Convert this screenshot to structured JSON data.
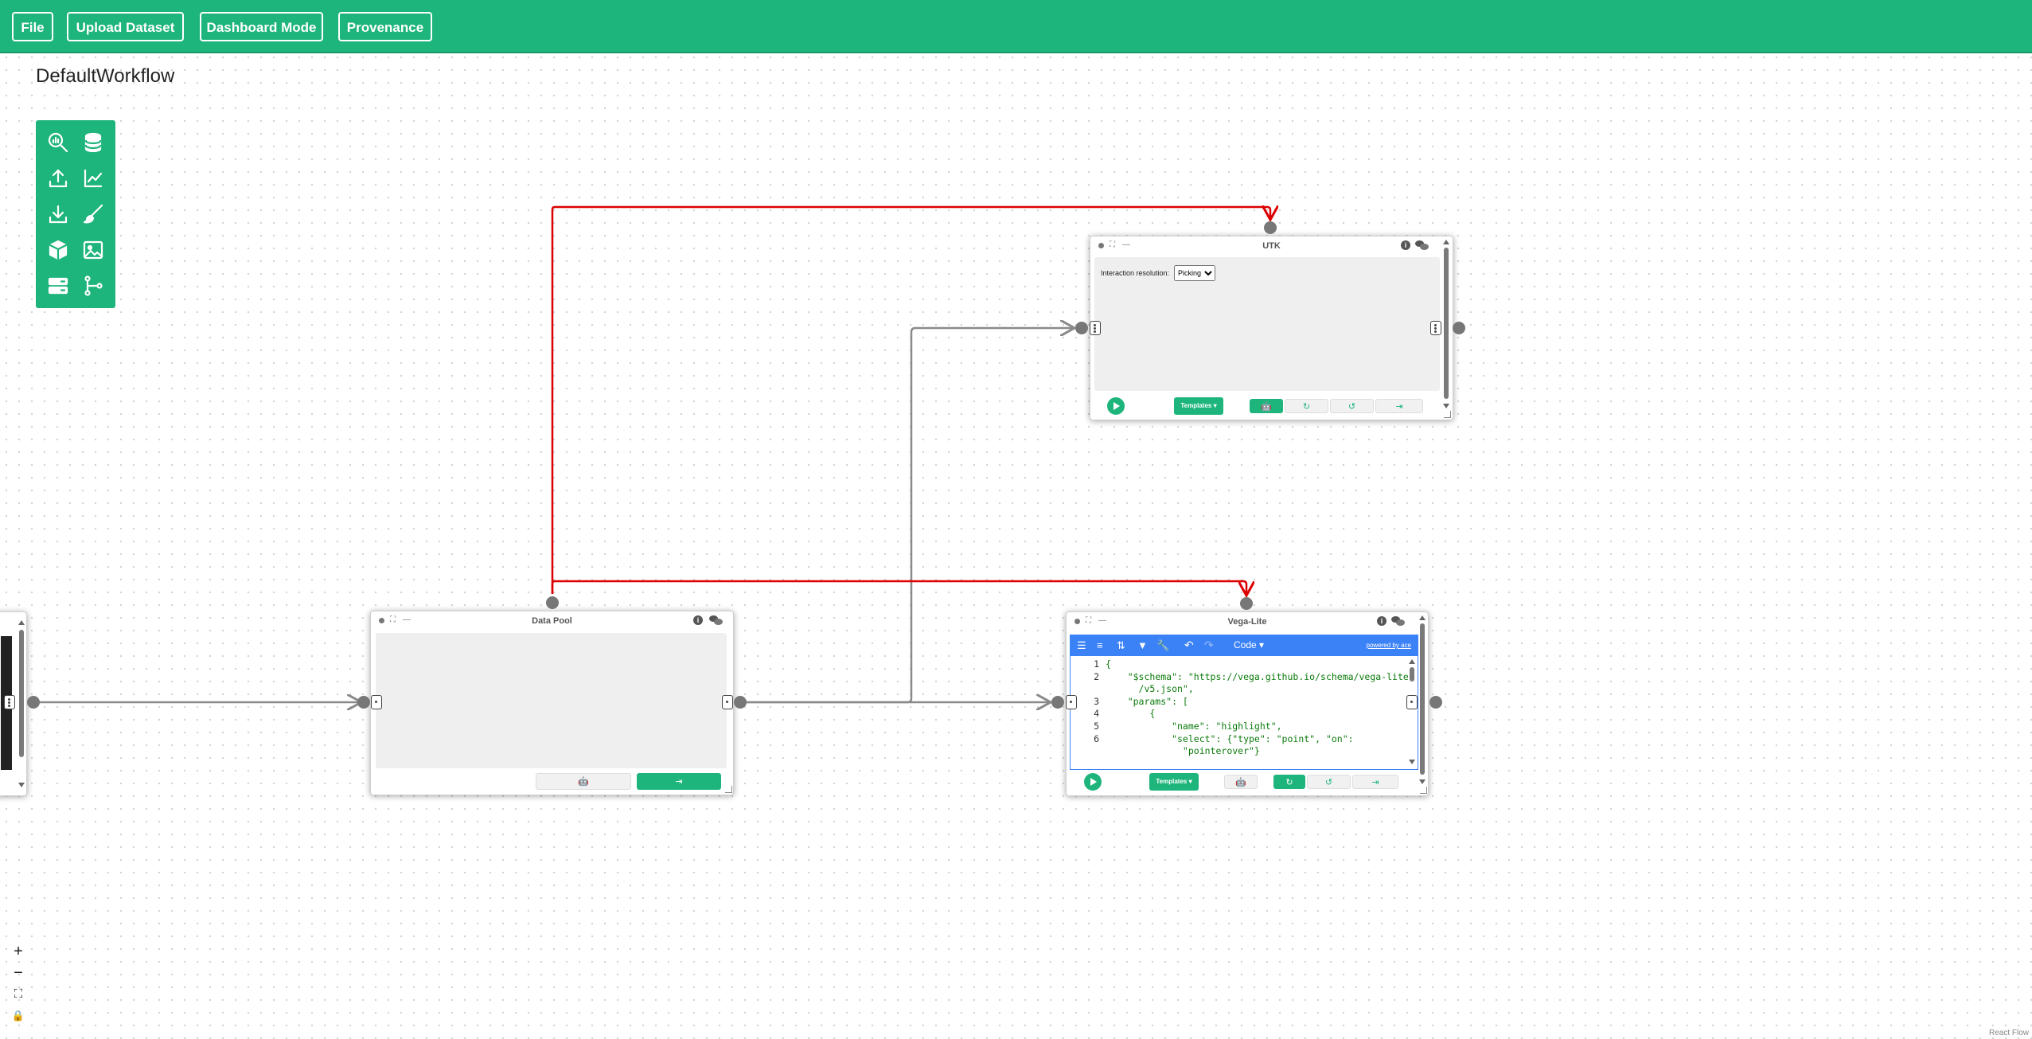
{
  "menu": {
    "file": "File",
    "upload": "Upload Dataset",
    "dashboard": "Dashboard Mode",
    "provenance": "Provenance"
  },
  "workflow": {
    "name": "DefaultWorkflow"
  },
  "palette": [
    "computation-analysis-icon",
    "database-icon",
    "upload-icon",
    "line-chart-icon",
    "download-icon",
    "brush-icon",
    "cube-icon",
    "image-icon",
    "server-icon",
    "merge-flow-icon"
  ],
  "nodes": {
    "utk": {
      "title": "UTK",
      "interaction_label": "Interaction resolution:",
      "interaction_value": "Picking",
      "interaction_options": [
        "Picking"
      ],
      "templates": "Templates ▾"
    },
    "data_pool": {
      "title": "Data Pool"
    },
    "vega": {
      "title": "Vega-Lite",
      "mode": "Code ▾",
      "powered_by": "powered by ace",
      "templates": "Templates ▾",
      "code_lines": [
        {
          "n": "1",
          "text": "{"
        },
        {
          "n": "2",
          "text": "    \"$schema\": \"https://vega.github.io/schema/vega-lite"
        },
        {
          "n": "",
          "text": "      /v5.json\","
        },
        {
          "n": "3",
          "text": "    \"params\": ["
        },
        {
          "n": "4",
          "text": "        {"
        },
        {
          "n": "5",
          "text": "            \"name\": \"highlight\","
        },
        {
          "n": "6",
          "text": "            \"select\": {\"type\": \"point\", \"on\":"
        },
        {
          "n": "",
          "text": "              \"pointerover\"}"
        }
      ]
    }
  },
  "colors": {
    "accent": "#1eb57c",
    "edge_default": "#8a8a8a",
    "edge_interaction": "#dd0000",
    "editor_toolbar": "#3b82f6"
  },
  "attribution": "React Flow"
}
